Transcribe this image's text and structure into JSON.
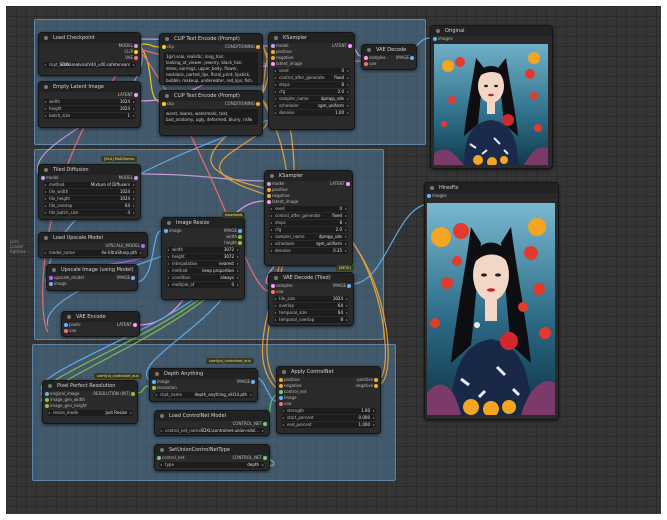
{
  "colors": {
    "canvas_bg": "#353535",
    "group_bg": "#5c96c8",
    "wire_model": "#c8a0e0",
    "wire_clip": "#ffd500",
    "wire_vae": "#ff6e6e",
    "wire_cond": "#f0a93a",
    "wire_latent": "#ff9cf9",
    "wire_image": "#64b5f6",
    "wire_control": "#6cd07a"
  },
  "nodes": {
    "load_checkpoint": {
      "title": "Load Checkpoint",
      "outputs": [
        "MODEL",
        "CLIP",
        "VAE"
      ],
      "ckpt_key": "ckpt_name",
      "ckpt_value": "SDXL\\realvisxlV40_v40.safetensors"
    },
    "empty_latent": {
      "title": "Empty Latent Image",
      "output": "LATENT",
      "width_key": "width",
      "width_value": "1024",
      "height_key": "height",
      "height_value": "1024",
      "batch_key": "batch_size",
      "batch_value": "1"
    },
    "clip_pos": {
      "title": "CLIP Text Encode (Prompt)",
      "input": "clip",
      "output": "CONDITIONING",
      "text": "1girl,solo, realistic, long_hair, looking_at_viewer, jewelry, black_hair, dress, earrings, upper_body, flower, necklace, parted_lips, floral_print, lipstick, bubble, makeup, underwater, red_lips, fish, fruit"
    },
    "clip_neg": {
      "title": "CLIP Text Encode (Prompt)",
      "input": "clip",
      "output": "CONDITIONING",
      "text": "worst, lowres, watermark, text, bad_anatomy, ugly, deformed, blurry, nsfw"
    },
    "ksampler1": {
      "title": "KSampler",
      "inputs": [
        "model",
        "positive",
        "negative",
        "latent_image"
      ],
      "output": "LATENT",
      "seed_key": "seed",
      "seed_value": "0",
      "control_key": "control_after_generate",
      "control_value": "fixed",
      "steps_key": "steps",
      "steps_value": "8",
      "cfg_key": "cfg",
      "cfg_value": "2.0",
      "sampler_key": "sampler_name",
      "sampler_value": "dpmpp_sde",
      "scheduler_key": "scheduler",
      "scheduler_value": "sgm_uniform",
      "denoise_key": "denoise",
      "denoise_value": "1.00"
    },
    "vae_decode1": {
      "title": "VAE Decode",
      "inputs": [
        "samples",
        "vae"
      ],
      "output": "IMAGE"
    },
    "original": {
      "title": "Original",
      "input": "images"
    },
    "tiled_diffusion": {
      "title": "Tiled Diffusion",
      "badge": "[BLA] MoD/Demo",
      "input": "model",
      "output": "MODEL",
      "method_key": "method",
      "method_value": "Mixture of Diffusers",
      "tw_key": "tile_width",
      "tw_value": "1024",
      "th_key": "tile_height",
      "th_value": "1024",
      "ov_key": "tile_overlap",
      "ov_value": "64",
      "bs_key": "tile_batch_size",
      "bs_value": "4"
    },
    "load_upscale": {
      "title": "Load Upscale Model",
      "output": "UPSCALE_MODEL",
      "model_key": "model_name",
      "model_value": "4x-UltraSharp.pth"
    },
    "upscale_image": {
      "title": "Upscale Image (using Model)",
      "inputs": [
        "upscale_model",
        "image"
      ],
      "output": "IMAGE"
    },
    "vae_encode": {
      "title": "VAE Encode",
      "inputs": [
        "pixels",
        "vae"
      ],
      "output": "LATENT"
    },
    "image_resize": {
      "title": "Image Resize",
      "badge": "essentials",
      "input": "image",
      "outputs": [
        "IMAGE",
        "width",
        "height"
      ],
      "width_key": "width",
      "width_value": "3072",
      "height_key": "height",
      "height_value": "3072",
      "interp_key": "interpolation",
      "interp_value": "nearest",
      "method_key": "method",
      "method_value": "keep proportion",
      "cond_key": "condition",
      "cond_value": "always",
      "mult_key": "multiple_of",
      "mult_value": "0"
    },
    "ksampler2": {
      "title": "KSampler",
      "inputs": [
        "model",
        "positive",
        "negative",
        "latent_image"
      ],
      "output": "LATENT",
      "seed_key": "seed",
      "seed_value": "0",
      "control_key": "control_after_generate",
      "control_value": "fixed",
      "steps_key": "steps",
      "steps_value": "8",
      "cfg_key": "cfg",
      "cfg_value": "2.0",
      "sampler_key": "sampler_name",
      "sampler_value": "dpmpp_sde",
      "scheduler_key": "scheduler",
      "scheduler_value": "sgm_uniform",
      "denoise_key": "denoise",
      "denoise_value": "0.35"
    },
    "vae_decode_tiled": {
      "title": "VAE Decode (Tiled)",
      "badge": "[BETA]",
      "inputs": [
        "samples",
        "vae"
      ],
      "output": "IMAGE",
      "tile_key": "tile_size",
      "tile_value": "1024",
      "overlap_key": "overlap",
      "overlap_value": "64",
      "temporal_key": "temporal_size",
      "temporal_value": "64",
      "tovl_key": "temporal_overlap",
      "tovl_value": "8"
    },
    "hires_fix": {
      "title": "HiresFix",
      "input": "images"
    },
    "pixel_perfect": {
      "title": "Pixel Perfect Resolution",
      "badge": "comfyui_controlnet_aux",
      "inputs": [
        "original_image",
        "image_gen_width",
        "image_gen_height"
      ],
      "output": "RESOLUTION (INT)",
      "mode_key": "resize_mode",
      "mode_value": "Just Resize"
    },
    "depth_anything": {
      "title": "Depth Anything",
      "badge": "comfyui_controlnet_aux",
      "inputs": [
        "image",
        "resolution"
      ],
      "output": "IMAGE",
      "ckpt_key": "ckpt_name",
      "ckpt_value": "depth_anything_vitl14.pth"
    },
    "load_controlnet": {
      "title": "Load ControlNet Model",
      "output": "CONTROL_NET",
      "cn_key": "control_net_name",
      "cn_value": "SDXL\\controlnet-union-sdxl..."
    },
    "set_union": {
      "title": "SetUnionControlNetType",
      "input": "control_net",
      "output": "CONTROL_NET",
      "type_key": "type",
      "type_value": "depth"
    },
    "apply_controlnet": {
      "title": "Apply ControlNet",
      "inputs": [
        "positive",
        "negative",
        "control_net",
        "image",
        "vae"
      ],
      "outputs": [
        "positive",
        "negative"
      ],
      "strength_key": "strength",
      "strength_value": "1.00",
      "start_key": "start_percent",
      "start_value": "0.000",
      "end_key": "end_percent",
      "end_value": "1.000"
    }
  },
  "reroute": {
    "label": "Lora\nLoader\nRgthree"
  }
}
